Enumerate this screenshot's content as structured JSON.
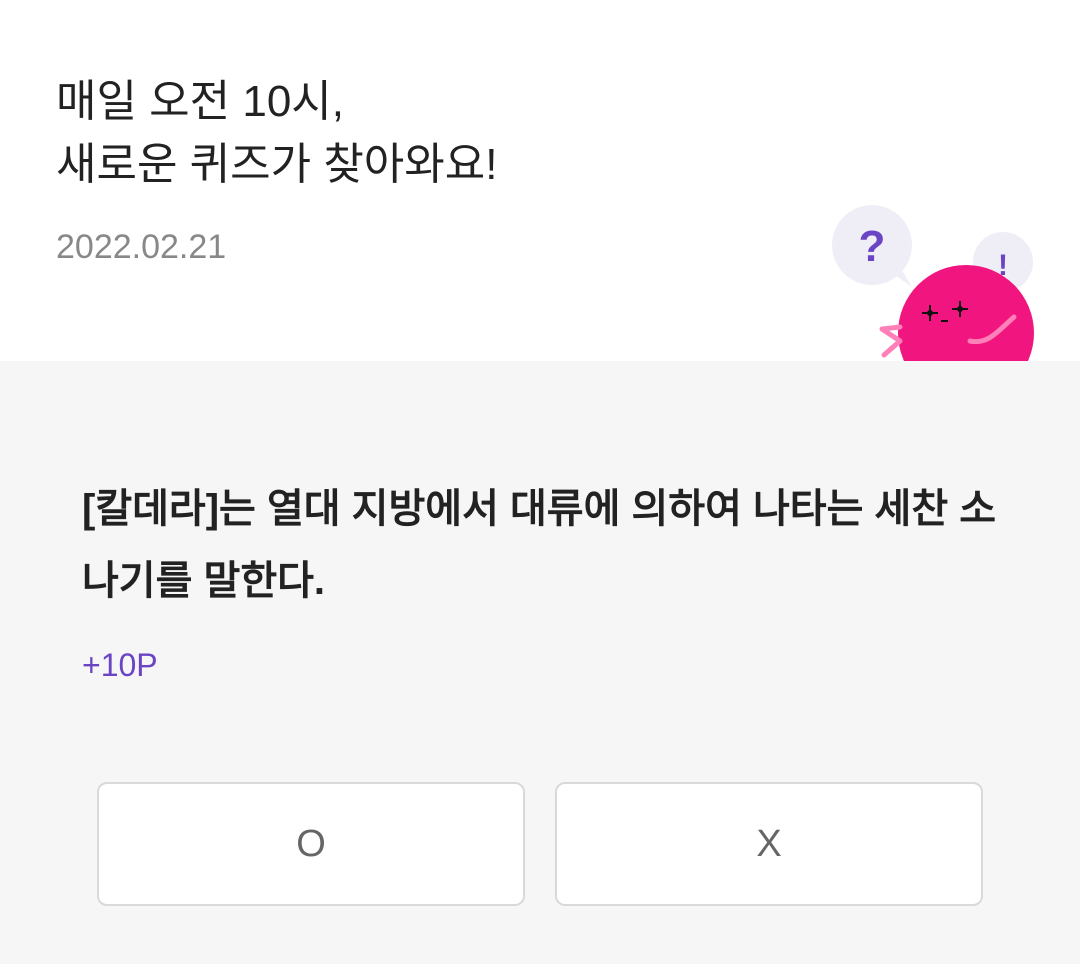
{
  "header": {
    "title": "매일 오전 10시,\n새로운 퀴즈가 찾아와요!",
    "date": "2022.02.21"
  },
  "mascot": {
    "question_bubble": "?",
    "exclaim_bubble": "!",
    "icon": "pink-blob-mascot",
    "body_color": "#f0157f",
    "bubble_color": "#efeef7",
    "mark_color": "#6a44c4"
  },
  "quiz": {
    "question": "[칼데라]는 열대 지방에서 대류에 의하여 나타는 세찬 소나기를 말한다.",
    "points": "+10P",
    "answers": [
      {
        "label": "O"
      },
      {
        "label": "X"
      }
    ]
  },
  "colors": {
    "accent": "#6a44c4",
    "quiz_background": "#f6f6f6",
    "date_text": "#888888"
  }
}
